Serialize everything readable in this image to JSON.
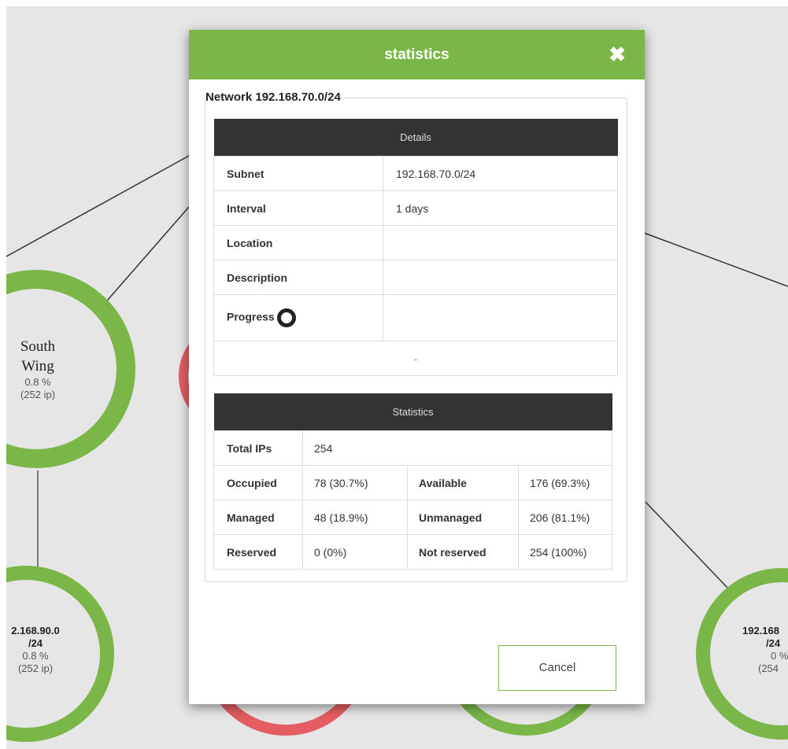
{
  "modal": {
    "title": "statistics",
    "close_glyph": "✖",
    "network_legend": "Network 192.168.70.0/24",
    "cancel_label": "Cancel"
  },
  "details": {
    "header": "Details",
    "rows": [
      {
        "label": "Subnet",
        "value": "192.168.70.0/24"
      },
      {
        "label": "Interval",
        "value": "1 days"
      },
      {
        "label": "Location",
        "value": ""
      },
      {
        "label": "Description",
        "value": ""
      },
      {
        "label": "Progress",
        "value": ""
      }
    ],
    "footer": "-"
  },
  "statistics": {
    "header": "Statistics",
    "total_label": "Total IPs",
    "total_value": "254",
    "rows": [
      {
        "k1": "Occupied",
        "v1": "78 (30.7%)",
        "k2": "Available",
        "v2": "176 (69.3%)"
      },
      {
        "k1": "Managed",
        "v1": "48 (18.9%)",
        "k2": "Unmanaged",
        "v2": "206 (81.1%)"
      },
      {
        "k1": "Reserved",
        "v1": "0 (0%)",
        "k2": "Not reserved",
        "v2": "254 (100%)"
      }
    ]
  },
  "background_nodes": {
    "south_wing": {
      "name_line1": "South",
      "name_line2": "Wing",
      "percent": "0.8 %",
      "ips": "(252 ip)"
    },
    "net_90": {
      "line1": "2.168.90.0",
      "line2": "/24",
      "percent": "0.8 %",
      "ips": "(252 ip)"
    },
    "net_right": {
      "line1": "192.168",
      "line2": "/24",
      "percent": "0 %",
      "ips": "(254"
    }
  },
  "colors": {
    "accent_green": "#7ab648",
    "node_red": "#e35d63",
    "table_header": "#333333",
    "canvas_bg": "#e6e6e6"
  }
}
